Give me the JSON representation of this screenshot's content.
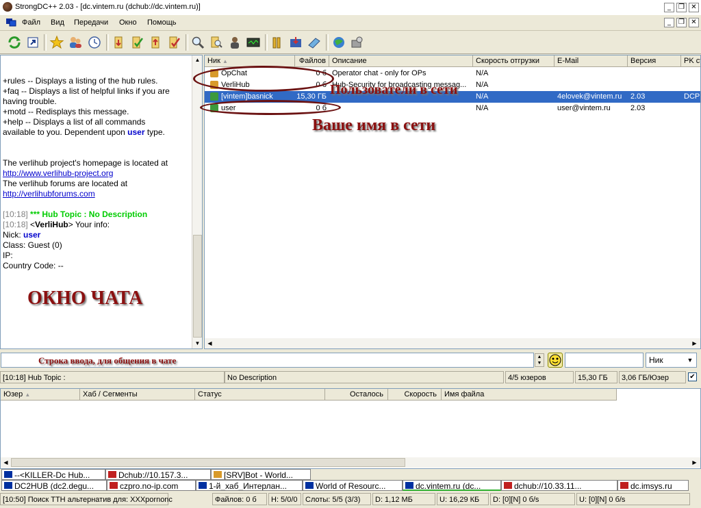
{
  "window": {
    "title": "StrongDC++ 2.03 - [dc.vintem.ru (dchub://dc.vintem.ru)]",
    "controls": [
      "_",
      "❐",
      "✕"
    ]
  },
  "menu": [
    "Файл",
    "Вид",
    "Передачи",
    "Окно",
    "Помощь"
  ],
  "menu_controls": [
    "_",
    "❐",
    "✕"
  ],
  "toolbar_icons": [
    "reconnect-icon",
    "follow-redirect-icon",
    "favorites-icon",
    "favorite-users-icon",
    "recent-hubs-icon",
    "queue-icon",
    "finished-icon",
    "upload-queue-icon",
    "finished-uploads-icon",
    "search-icon",
    "adl-search-icon",
    "search-spy-icon",
    "notepad-icon",
    "network-stats-icon",
    "open-filelist-icon",
    "settings-icon",
    "refresh-filelist-icon",
    "hash-progress-icon"
  ],
  "chat": {
    "lines": [
      {
        "segments": [
          {
            "t": "+rules      -- Displays a listing of the hub rules."
          }
        ]
      },
      {
        "segments": [
          {
            "t": "+faq        -- Displays a list of helpful links if you are"
          }
        ]
      },
      {
        "segments": [
          {
            "t": "having trouble."
          }
        ]
      },
      {
        "segments": [
          {
            "t": "+motd       -- Redisplays this message."
          }
        ]
      },
      {
        "segments": [
          {
            "t": "+help       -- Displays a list of all commands"
          }
        ]
      },
      {
        "segments": [
          {
            "t": "available to you. Dependent upon "
          },
          {
            "t": "user",
            "c": "blue"
          },
          {
            "t": " type."
          }
        ]
      },
      {
        "segments": [
          {
            "t": ""
          }
        ]
      },
      {
        "segments": [
          {
            "t": ""
          }
        ]
      },
      {
        "segments": [
          {
            "t": "The verlihub project's homepage is located at"
          }
        ]
      },
      {
        "segments": [
          {
            "t": "http://www.verlihub-project.org",
            "c": "link"
          }
        ]
      },
      {
        "segments": [
          {
            "t": "The verlihub forums are located at"
          }
        ]
      },
      {
        "segments": [
          {
            "t": "http://verlihubforums.com",
            "c": "link"
          }
        ]
      },
      {
        "segments": [
          {
            "t": ""
          }
        ]
      },
      {
        "segments": [
          {
            "t": "[10:18] ",
            "c": "time"
          },
          {
            "t": "*** Hub Topic :        No Description",
            "c": "green"
          }
        ]
      },
      {
        "segments": [
          {
            "t": "[10:18] ",
            "c": "time"
          },
          {
            "t": "<"
          },
          {
            "t": "VerliHub",
            "c": "bold"
          },
          {
            "t": "> Your info:"
          }
        ]
      },
      {
        "segments": [
          {
            "t": "Nick: "
          },
          {
            "t": "user",
            "c": "blue"
          }
        ]
      },
      {
        "segments": [
          {
            "t": "Class: Guest (0)"
          }
        ]
      },
      {
        "segments": [
          {
            "t": "IP:"
          }
        ]
      },
      {
        "segments": [
          {
            "t": "Country Code: --"
          }
        ]
      }
    ]
  },
  "annotations": {
    "chat_window": "ОКНО ЧАТА",
    "users_online": "Пользователи в сети",
    "your_name": "Ваше имя в сети",
    "input_line": "Строка ввода, для общения в чате"
  },
  "userlist": {
    "columns": [
      "Ник",
      "Файлов",
      "Описание",
      "Скорость отгрузки",
      "E-Mail",
      "Версия",
      "PK ст"
    ],
    "rows": [
      {
        "nick": "OpChat",
        "files": "0 б",
        "desc": "Operator chat - only for OPs",
        "speed": "N/A",
        "email": "",
        "version": "",
        "pk": "",
        "icon": "#d89a2a",
        "selected": false
      },
      {
        "nick": "VerliHub",
        "files": "0 б",
        "desc": "Hub-Security for broadcasting messag...",
        "speed": "N/A",
        "email": "",
        "version": "",
        "pk": "",
        "icon": "#d89a2a",
        "selected": false
      },
      {
        "nick": "[vintem]basnick",
        "files": "15,30 ГБ",
        "desc": "",
        "speed": "N/A",
        "email": "4elovek@vintem.ru",
        "version": "2.03",
        "pk": "DCP",
        "icon": "#3c9a3c",
        "selected": true
      },
      {
        "nick": "user",
        "files": "0 б",
        "desc": "",
        "speed": "N/A",
        "email": "user@vintem.ru",
        "version": "2.03",
        "pk": "",
        "icon": "#3c9a3c",
        "selected": false
      }
    ]
  },
  "input": {
    "value": "",
    "nick_select": "Ник"
  },
  "hub_status": {
    "topic": "[10:18] Hub Topic :",
    "description": "No Description",
    "users": "4/5 юзеров",
    "share": "15,30 ГБ",
    "per_user": "3,06 ГБ/Юзер"
  },
  "transfers": {
    "columns": [
      "Юзер",
      "Хаб / Сегменты",
      "Статус",
      "Осталось",
      "Скорость",
      "Имя файла"
    ]
  },
  "tabs_row1": [
    {
      "label": "--<KILLER-Dc Hub...",
      "color": "#0030a0",
      "active": false
    },
    {
      "label": "Dchub://10.157.3...",
      "color": "#c02020",
      "active": false
    },
    {
      "label": "[SRV]Bot - World...",
      "color": "#d89a2a",
      "active": false
    }
  ],
  "tabs_row2": [
    {
      "label": "DC2HUB (dc2.degu...",
      "color": "#0030a0",
      "active": false
    },
    {
      "label": "czpro.no-ip.com",
      "color": "#c02020",
      "active": false
    },
    {
      "label": "1-й_хаб_Интерлан...",
      "color": "#0030a0",
      "active": false
    },
    {
      "label": "World of Resourc...",
      "color": "#0030a0",
      "active": false
    },
    {
      "label": "dc.vintem.ru (dc...",
      "color": "#0030a0",
      "active": true
    },
    {
      "label": "dchub://10.33.11...",
      "color": "#c02020",
      "active": false
    },
    {
      "label": "dc.imsys.ru",
      "color": "#c02020",
      "active": false
    }
  ],
  "statusbar": {
    "message": "[10:50] Поиск TTH альтернатив для: XXXpornonc",
    "files": "Файлов: 0 б",
    "hubs": "H: 5/0/0",
    "slots": "Слоты: 5/5 (3/3)",
    "down": "D: 1,12 МБ",
    "up": "U: 16,29 КБ",
    "dspeed": "D: [0][N] 0 б/s",
    "uspeed": "U: [0][N] 0 б/s"
  }
}
